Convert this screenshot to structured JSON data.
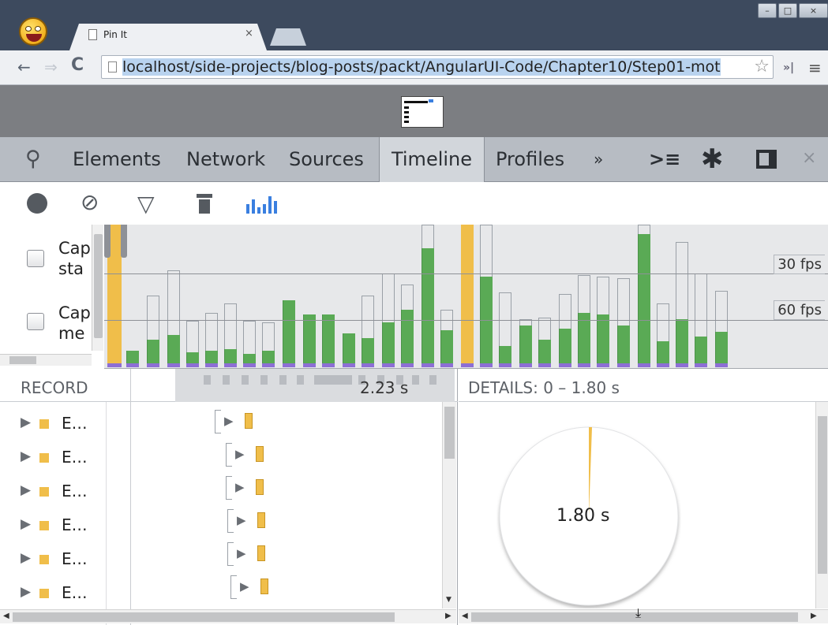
{
  "browser": {
    "tab_title": "Pin It",
    "tab_close": "×",
    "url": "localhost/side-projects/blog-posts/packt/AngularUI-Code/Chapter10/Step01-mot",
    "window_buttons": {
      "minimize": "–",
      "maximize": "□",
      "close": "×"
    },
    "icons": {
      "back": "back-arrow-icon",
      "forward": "forward-arrow-icon",
      "reload": "reload-icon",
      "star": "star-icon",
      "menu": "hamburger-menu-icon"
    }
  },
  "devtools": {
    "tabs": [
      "Elements",
      "Network",
      "Sources",
      "Timeline",
      "Profiles"
    ],
    "active_tab": "Timeline",
    "more": "»",
    "timeline_controls": [
      "record",
      "clear",
      "filter",
      "garbage-collect",
      "frames-view"
    ],
    "overview": {
      "checkbox_labels": [
        {
          "line1": "Cap",
          "line2": "sta"
        },
        {
          "line1": "Cap",
          "line2": "me"
        }
      ],
      "fps_labels": [
        "30 fps",
        "60 fps"
      ]
    },
    "records": {
      "header": "RECORD",
      "duration": "2.23 s",
      "rows": [
        "E…",
        "E…",
        "E…",
        "E…",
        "E…",
        "E…"
      ]
    },
    "details": {
      "header": "DETAILS: 0 – 1.80 s",
      "pie_label": "1.80 s"
    },
    "colors": {
      "loading": "#f0be4a",
      "rendering": "#8d6fd5",
      "painting": "#5aaa55",
      "selected_frame": "#f0be4a"
    }
  }
}
